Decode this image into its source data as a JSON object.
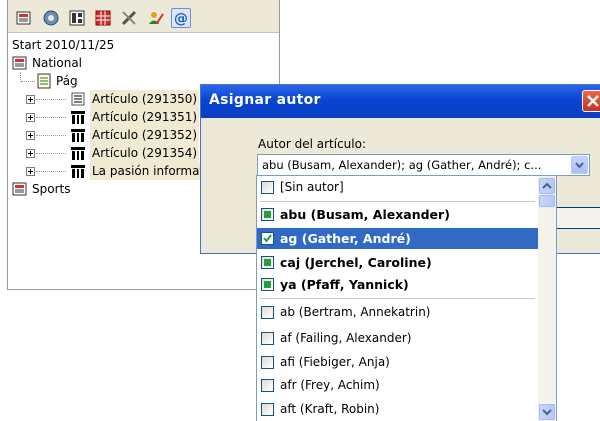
{
  "tree": {
    "toolbar_icons": [
      "newspaper-icon",
      "gear-icon",
      "layout-icon",
      "grid-icon",
      "tools-icon",
      "user-pencil-icon",
      "at-sign-icon"
    ],
    "start_label": "Start 2010/11/25",
    "national_label": "National",
    "page_label": "Pág",
    "items": [
      {
        "label": "Artículo (291350)"
      },
      {
        "label": "Artículo (291351)"
      },
      {
        "label": "Artículo (291352)"
      },
      {
        "label": "Artículo (291354)"
      },
      {
        "label": "La pasión informativa"
      }
    ],
    "sports_label": "Sports"
  },
  "dialog": {
    "title": "Asignar autor",
    "field_label": "Autor del artículo:",
    "combo_value": "abu (Busam, Alexander); ag (Gather, André); c..."
  },
  "list": {
    "none_item": {
      "label": "[Sin autor]"
    },
    "bold_items": [
      {
        "label": "abu (Busam, Alexander)",
        "checked": "mixed"
      },
      {
        "label": "ag (Gather, André)",
        "checked": "checked",
        "selected": true
      },
      {
        "label": "caj (Jerchel, Caroline)",
        "checked": "mixed"
      },
      {
        "label": "ya (Pfaff, Yannick)",
        "checked": "mixed"
      }
    ],
    "plain_items": [
      {
        "label": "ab (Bertram, Annekatrin)"
      },
      {
        "label": "af (Failing, Alexander)"
      },
      {
        "label": "afi (Fiebiger, Anja)"
      },
      {
        "label": "afr (Frey, Achim)"
      },
      {
        "label": "aft (Kraft, Robin)"
      }
    ]
  },
  "colors": {
    "title_bar": "#0a46d4",
    "selection": "#316ac5",
    "close_button": "#d9401f",
    "partial_check": "#20a040"
  }
}
